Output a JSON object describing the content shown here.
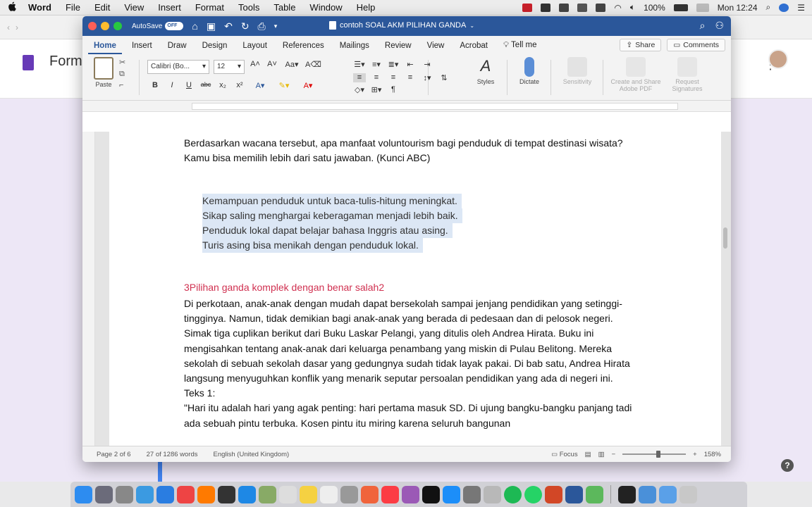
{
  "menubar": {
    "app": "Word",
    "items": [
      "File",
      "Edit",
      "View",
      "Insert",
      "Format",
      "Tools",
      "Table",
      "Window",
      "Help"
    ],
    "battery": "100%",
    "clock": "Mon 12:24"
  },
  "background_app": {
    "title": "Form"
  },
  "word": {
    "autosave_label": "AutoSave",
    "autosave_state": "OFF",
    "doc_title": "contoh SOAL AKM PILIHAN GANDA",
    "tabs": [
      "Home",
      "Insert",
      "Draw",
      "Design",
      "Layout",
      "References",
      "Mailings",
      "Review",
      "View",
      "Acrobat"
    ],
    "tell_me": "Tell me",
    "share": "Share",
    "comments": "Comments",
    "ribbon": {
      "paste": "Paste",
      "font_name": "Calibri (Bo...",
      "font_size": "12",
      "styles": "Styles",
      "dictate": "Dictate",
      "sensitivity": "Sensitivity",
      "create_share_pdf": "Create and Share Adobe PDF",
      "request_signatures": "Request Signatures"
    },
    "document": {
      "question": "Berdasarkan wacana tersebut, apa manfaat voluntourism bagi penduduk di tempat destinasi wisata? Kamu bisa memilih lebih dari satu jawaban. (Kunci ABC)",
      "options": [
        "Kemampuan penduduk untuk baca-tulis-hitung meningkat.",
        "Sikap saling menghargai keberagaman menjadi lebih baik.",
        "Penduduk lokal dapat belajar bahasa Inggris atau asing.",
        "Turis asing bisa menikah dengan penduduk lokal."
      ],
      "heading": "3Pilihan ganda komplek dengan benar salah2",
      "paragraph1": "Di perkotaan, anak-anak dengan mudah dapat bersekolah sampai jenjang pendidikan yang setinggi-tingginya. Namun, tidak demikian bagi anak-anak yang berada di pedesaan dan di pelosok negeri.",
      "paragraph2": "Simak tiga cuplikan berikut dari Buku Laskar Pelangi, yang ditulis oleh Andrea Hirata. Buku ini mengisahkan tentang anak-anak dari keluarga penambang yang miskin di Pulau Belitong. Mereka sekolah di sebuah sekolah dasar yang gedungnya sudah tidak layak pakai. Di bab satu, Andrea Hirata langsung menyuguhkan konflik yang menarik seputar persoalan pendidikan yang ada di negeri ini.",
      "teks_label": "Teks 1:",
      "quote": "\"Hari itu adalah hari yang agak penting: hari pertama masuk SD. Di ujung bangku-bangku panjang tadi ada sebuah pintu terbuka. Kosen pintu itu miring karena seluruh bangunan"
    },
    "status": {
      "page": "Page 2 of 6",
      "words": "27 of 1286 words",
      "language": "English (United Kingdom)",
      "focus": "Focus",
      "zoom": "158%"
    }
  }
}
